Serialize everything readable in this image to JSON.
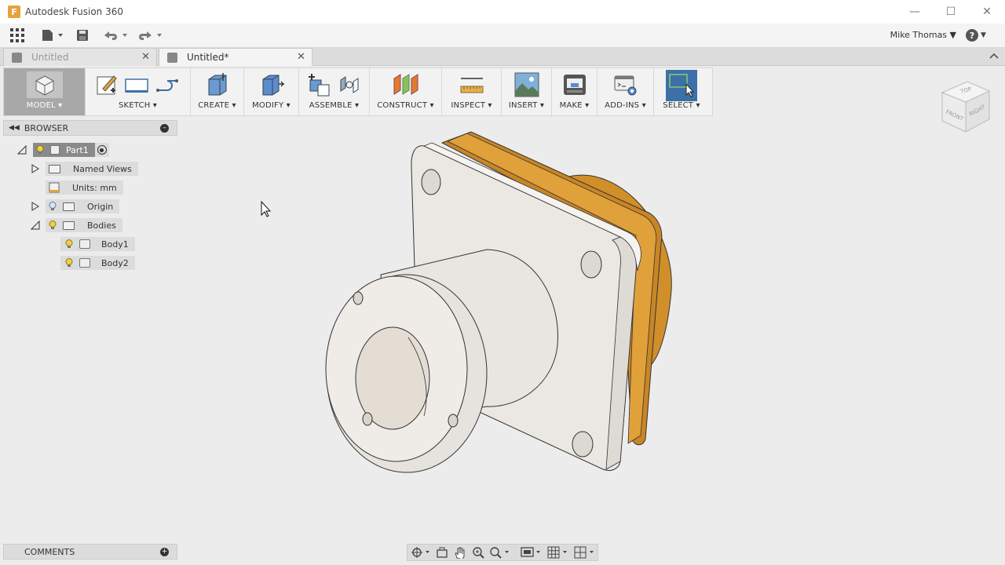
{
  "app": {
    "title": "Autodesk Fusion 360",
    "logo_letter": "F"
  },
  "window_controls": {
    "minimize": "—",
    "maximize": "☐",
    "close": "✕"
  },
  "quick_access": {
    "user_name": "Mike Thomas ▼",
    "help_label": "?",
    "help_caret": "▼"
  },
  "tabs": [
    {
      "label": "Untitled",
      "active": false
    },
    {
      "label": "Untitled*",
      "active": true
    }
  ],
  "toolbar": {
    "model": "MODEL ▾",
    "sketch": "SKETCH ▾",
    "create": "CREATE ▾",
    "modify": "MODIFY ▾",
    "assemble": "ASSEMBLE ▾",
    "construct": "CONSTRUCT ▾",
    "inspect": "INSPECT ▾",
    "insert": "INSERT ▾",
    "make": "MAKE ▾",
    "addins": "ADD-INS ▾",
    "select": "SELECT ▾"
  },
  "browser": {
    "title": "BROWSER",
    "tree": {
      "part": "Part1",
      "named_views": "Named Views",
      "units": "Units: mm",
      "origin": "Origin",
      "bodies": "Bodies",
      "body1": "Body1",
      "body2": "Body2"
    }
  },
  "viewcube": {
    "top": "TOP",
    "front": "FRONT",
    "right": "RIGHT"
  },
  "comments": {
    "title": "COMMENTS"
  },
  "colors": {
    "accent": "#3d70a8",
    "body_orange": "#d18f2a",
    "body_white": "#efece7"
  }
}
